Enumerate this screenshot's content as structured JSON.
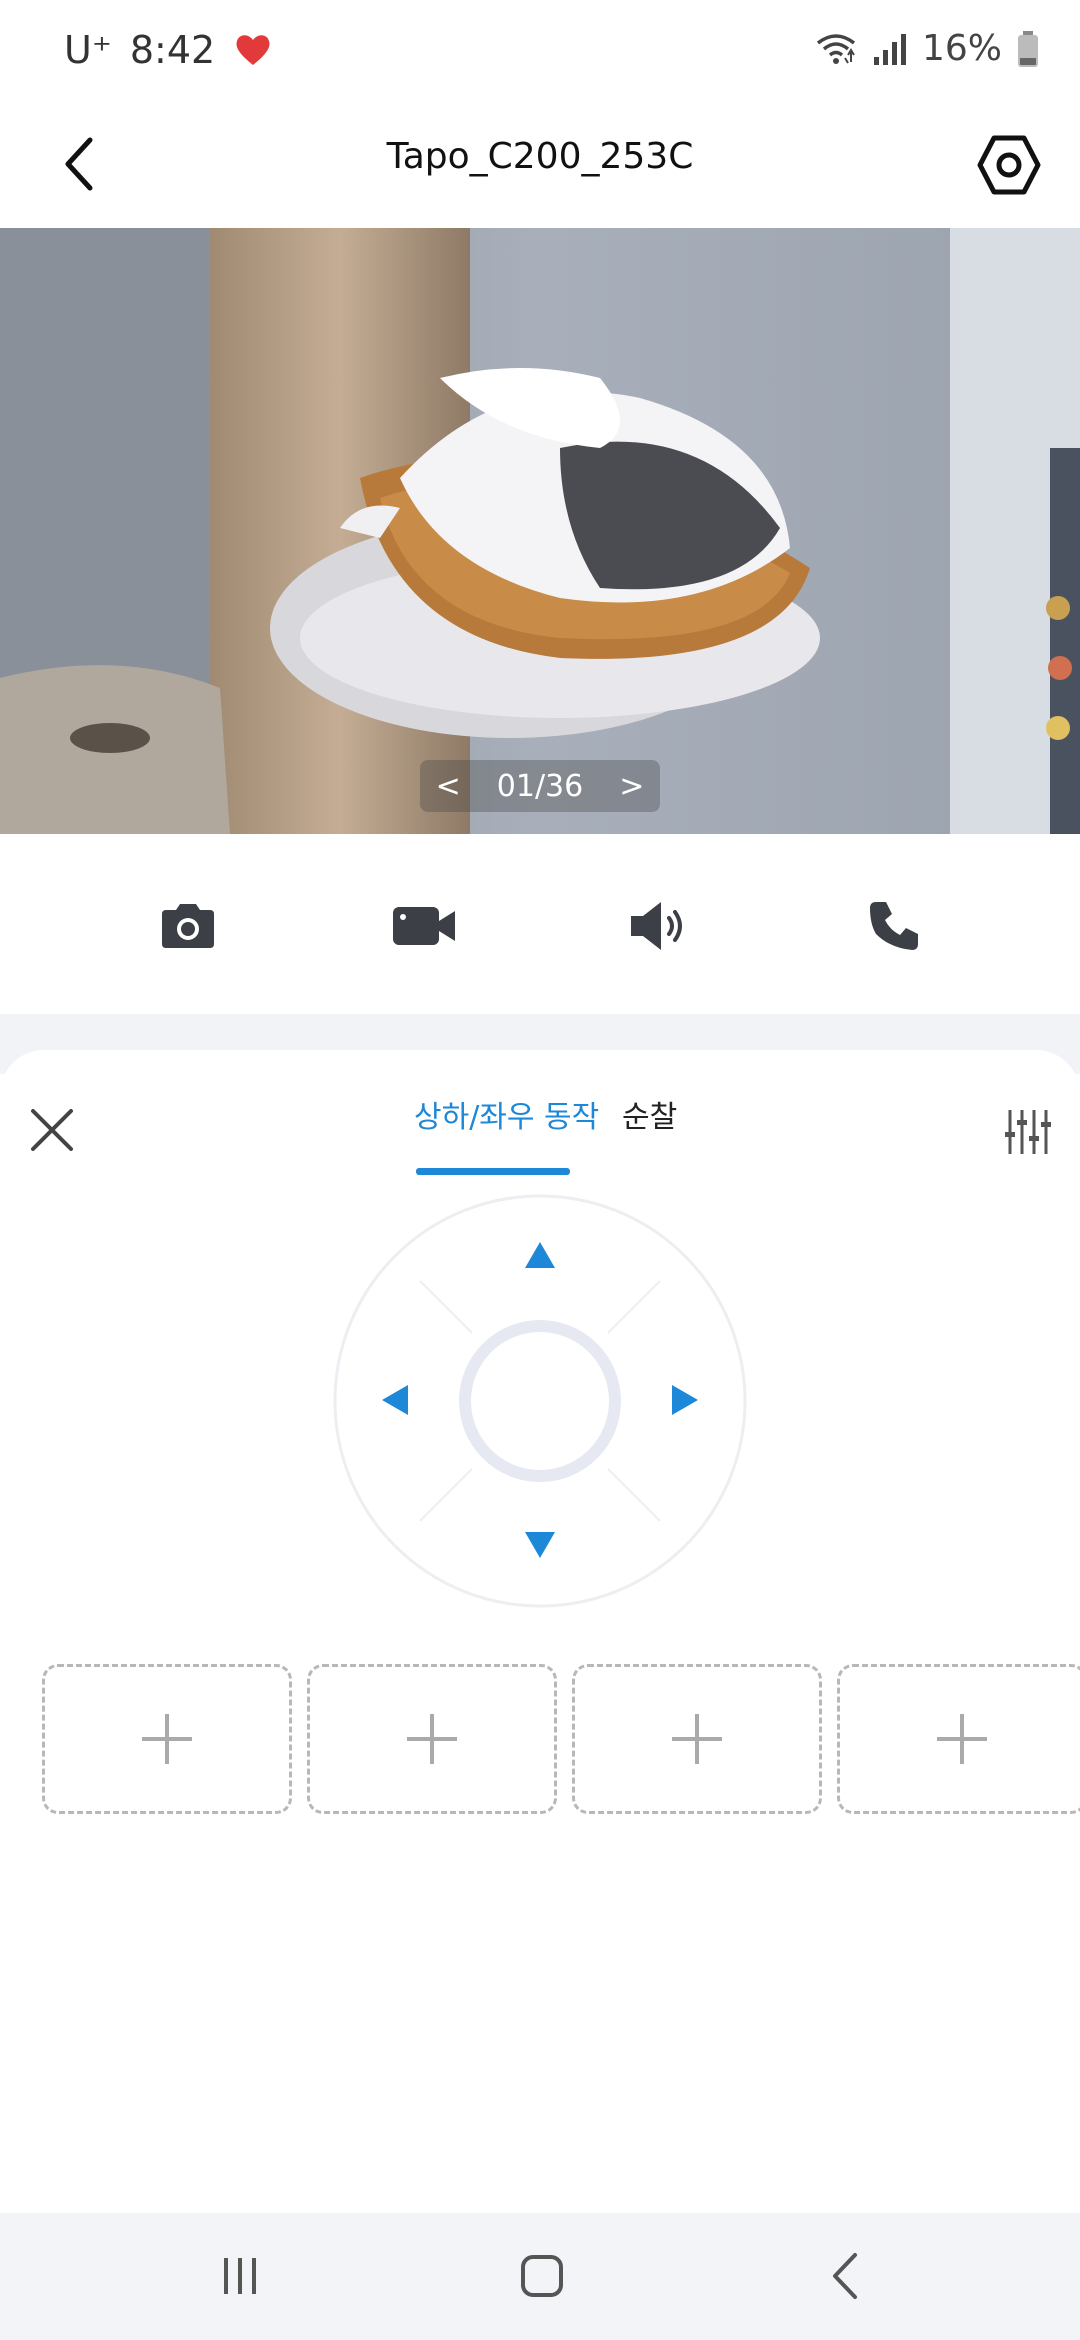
{
  "status_bar": {
    "carrier": "U⁺",
    "time": "8:42",
    "battery": "16%",
    "icons": [
      "heart-icon",
      "wifi-icon",
      "signal-icon",
      "battery-icon"
    ]
  },
  "header": {
    "title": "Tapo_C200_253C",
    "back_icon": "chevron-left-icon",
    "settings_icon": "hex-settings-icon"
  },
  "video": {
    "page_indicator": {
      "prev": "<",
      "current": "01/36",
      "next": ">"
    }
  },
  "actions": {
    "items": [
      "camera-icon",
      "video-record-icon",
      "speaker-icon",
      "phone-icon"
    ]
  },
  "panel": {
    "tabs": [
      {
        "label": "상하/좌우 동작",
        "active": true
      },
      {
        "label": "순찰",
        "active": false
      }
    ],
    "accent_color": "#1e88d8",
    "preset_slots": [
      "+",
      "+",
      "+",
      "+"
    ]
  },
  "nav": {
    "items": [
      "recent-apps-icon",
      "home-icon",
      "back-icon"
    ]
  }
}
